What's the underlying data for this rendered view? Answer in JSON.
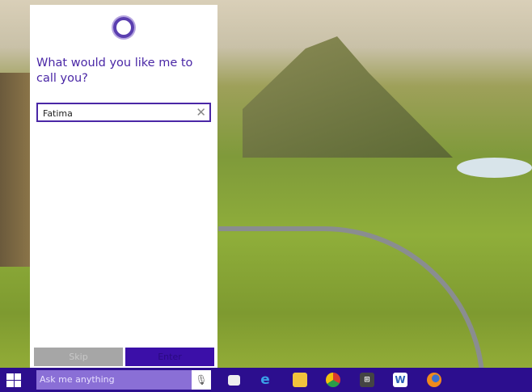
{
  "cortana": {
    "question": "What would you like me to call you?",
    "name_value": "Fatima",
    "skip_label": "Skip",
    "enter_label": "Enter"
  },
  "taskbar": {
    "search_placeholder": "Ask me anything",
    "apps": [
      "task-view",
      "internet-explorer",
      "file-explorer",
      "chrome",
      "store",
      "word",
      "firefox"
    ]
  }
}
